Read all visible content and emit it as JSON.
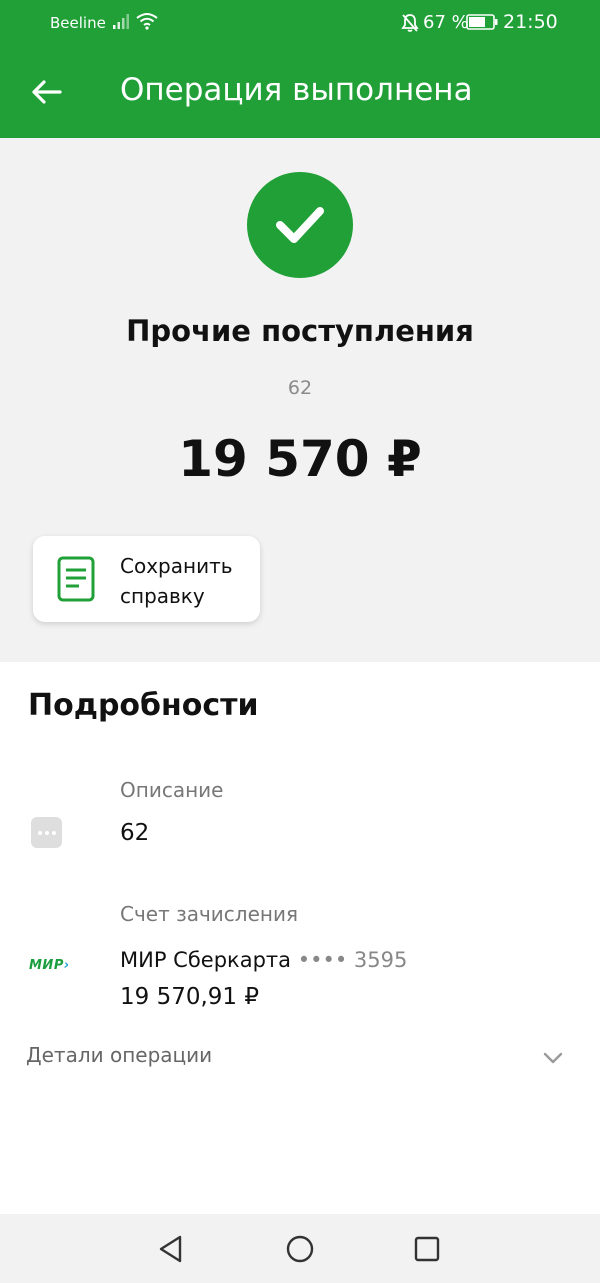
{
  "status_bar": {
    "carrier": "Beeline",
    "battery_percent": "67 %",
    "time": "21:50"
  },
  "toolbar": {
    "title": "Операция выполнена"
  },
  "summary": {
    "title": "Прочие поступления",
    "subtitle": "62",
    "amount": "19 570 ₽",
    "save_button_label": "Сохранить справку"
  },
  "details": {
    "title": "Подробности",
    "description": {
      "label": "Описание",
      "value": "62"
    },
    "account": {
      "label": "Счет зачисления",
      "logo_text": "МИР",
      "name": "МИР Сберкарта",
      "mask": "•••• 3595",
      "balance": "19 570,91 ₽"
    },
    "operation_details_label": "Детали операции"
  },
  "colors": {
    "accent": "#21a038",
    "summary_bg": "#f2f2f2"
  },
  "icons": [
    "back-arrow-icon",
    "checkmark-icon",
    "document-icon",
    "dots-icon",
    "mir-logo-icon",
    "chevron-down-icon"
  ]
}
